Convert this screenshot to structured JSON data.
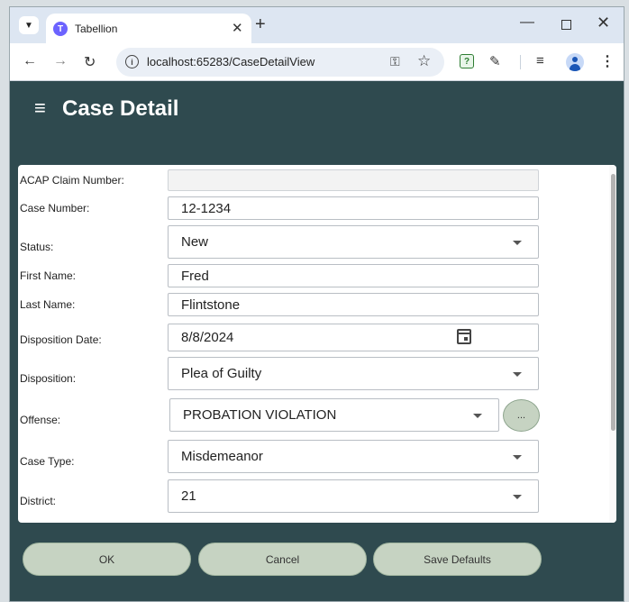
{
  "browser": {
    "tab_title": "Tabellion",
    "url": "localhost:65283/CaseDetailView"
  },
  "header": {
    "title": "Case Detail"
  },
  "form": {
    "acap_claim_number": {
      "label": "ACAP Claim Number:",
      "value": ""
    },
    "case_number": {
      "label": "Case Number:",
      "value": "12-1234"
    },
    "status": {
      "label": "Status:",
      "value": "New"
    },
    "first_name": {
      "label": "First Name:",
      "value": "Fred"
    },
    "last_name": {
      "label": "Last Name:",
      "value": "Flintstone"
    },
    "disposition_date": {
      "label": "Disposition Date:",
      "value": "8/8/2024"
    },
    "disposition": {
      "label": "Disposition:",
      "value": "Plea of Guilty"
    },
    "offense": {
      "label": "Offense:",
      "value": "PROBATION VIOLATION",
      "more_label": "..."
    },
    "case_type": {
      "label": "Case Type:",
      "value": "Misdemeanor"
    },
    "district": {
      "label": "District:",
      "value": "21"
    }
  },
  "actions": {
    "ok": "OK",
    "cancel": "Cancel",
    "save_defaults": "Save Defaults"
  }
}
